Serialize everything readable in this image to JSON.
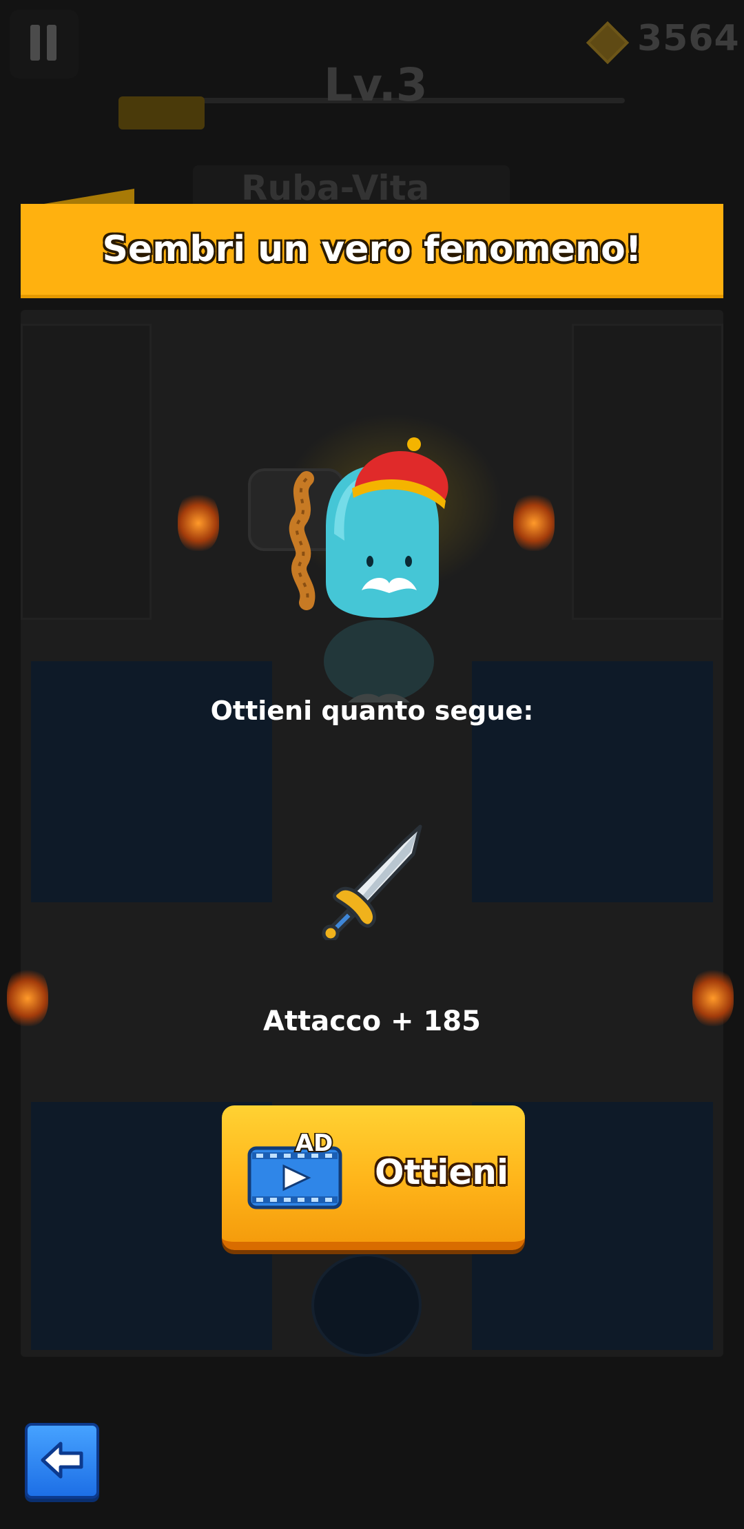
{
  "hud": {
    "gem_count": "3564",
    "level": "Lv.3",
    "xp_progress_fraction": 0.17,
    "skill_name": "Ruba-Vita"
  },
  "banner": {
    "title": "Sembri un vero fenomeno!"
  },
  "reward": {
    "heading": "Ottieni quanto segue:",
    "item_icon": "sword-icon",
    "value": "Attacco + 185"
  },
  "get_button": {
    "ad_badge": "AD",
    "label": "Ottieni"
  },
  "back_button": {
    "icon": "back-arrow-icon"
  },
  "colors": {
    "banner": "#ffb10f",
    "get_button": "#ffb51a",
    "back_button": "#1d6fe6",
    "overlay_dim": "#131313"
  }
}
